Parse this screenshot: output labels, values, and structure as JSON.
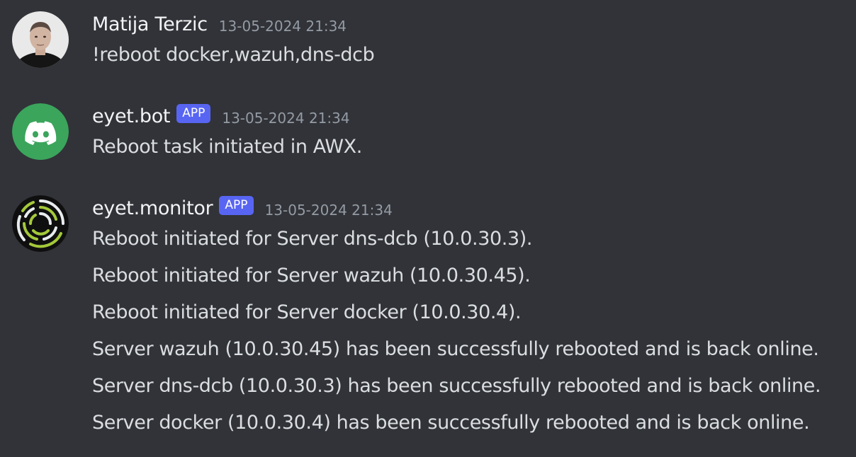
{
  "messages": [
    {
      "author": "Matija Terzic",
      "timestamp": "13-05-2024 21:34",
      "avatar_icon": "user-photo-avatar",
      "lines": [
        "!reboot docker,wazuh,dns-dcb"
      ]
    },
    {
      "author": "eyet.bot",
      "badge": "APP",
      "timestamp": "13-05-2024 21:34",
      "avatar_icon": "discord-logo-icon",
      "avatar_color": "#3ba55c",
      "lines": [
        "Reboot task initiated in AWX."
      ]
    },
    {
      "author": "eyet.monitor",
      "badge": "APP",
      "timestamp": "13-05-2024 21:34",
      "avatar_icon": "monitor-rings-logo",
      "avatar_color": "#a4c93a",
      "lines": [
        "Reboot initiated for Server dns-dcb (10.0.30.3).",
        "Reboot initiated for Server wazuh (10.0.30.45).",
        "Reboot initiated for Server docker (10.0.30.4).",
        "Server wazuh (10.0.30.45) has been successfully rebooted and is back online.",
        "Server dns-dcb (10.0.30.3) has been successfully rebooted and is back online.",
        "Server docker (10.0.30.4) has been successfully rebooted and is back online."
      ]
    }
  ],
  "colors": {
    "background": "#313338",
    "text": "#dbdee1",
    "username": "#f2f3f5",
    "timestamp": "#949ba4",
    "badge": "#5865f2"
  }
}
